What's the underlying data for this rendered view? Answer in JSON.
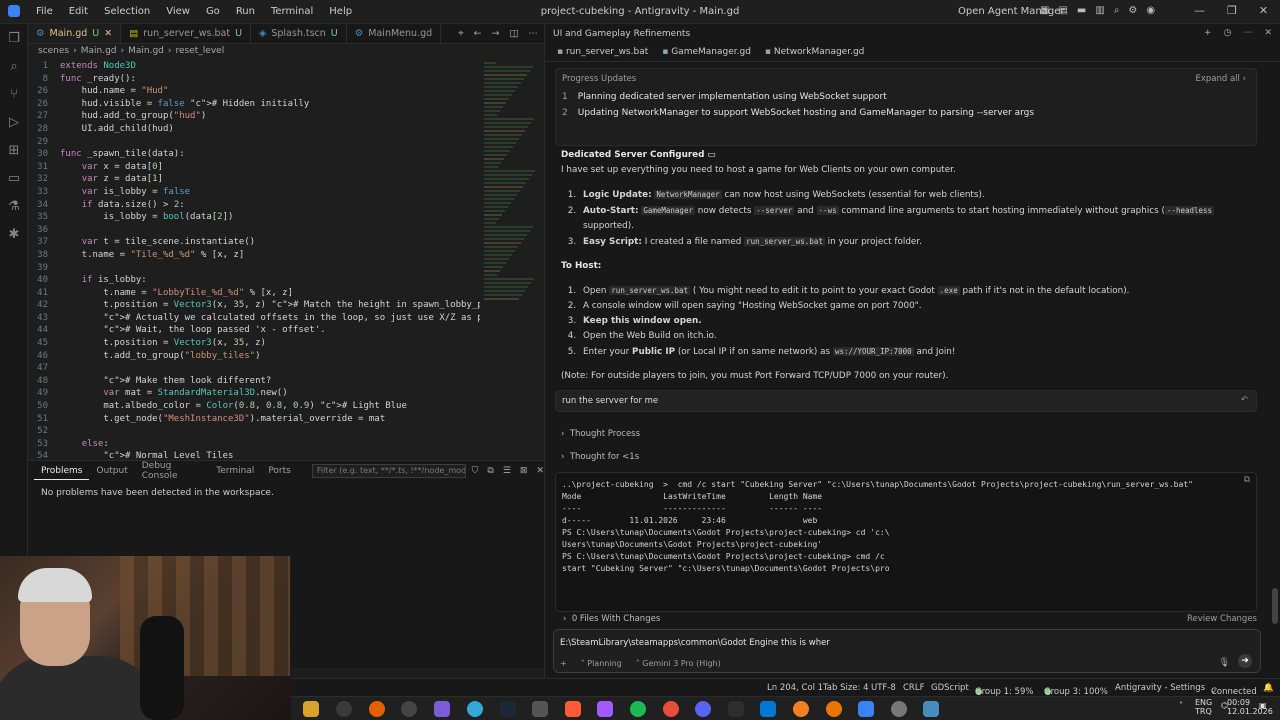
{
  "titlebar": {
    "menu": [
      "File",
      "Edit",
      "Selection",
      "View",
      "Go",
      "Run",
      "Terminal",
      "Help"
    ],
    "title": "project-cubeking - Antigravity - Main.gd",
    "open_agent_manager": "Open Agent Manager"
  },
  "editor": {
    "tabs": [
      {
        "label": "Main.gd",
        "badge": "U",
        "active": true
      },
      {
        "label": "run_server_ws.bat",
        "badge": "U"
      },
      {
        "label": "Splash.tscn",
        "badge": "U"
      },
      {
        "label": "MainMenu.gd",
        "badge": ""
      }
    ],
    "breadcrumb": [
      "scenes",
      "Main.gd",
      "Main.gd",
      "reset_level"
    ],
    "code": [
      {
        "n": "1",
        "t": "extends Node3D"
      },
      {
        "n": "8",
        "t": "func _ready():"
      },
      {
        "n": "26",
        "t": "\thud.name = \"Hud\""
      },
      {
        "n": "26",
        "t": "\thud.visible = false # Hidden initially"
      },
      {
        "n": "27",
        "t": "\thud.add_to_group(\"hud\")"
      },
      {
        "n": "28",
        "t": "\tUI.add_child(hud)"
      },
      {
        "n": "29",
        "t": ""
      },
      {
        "n": "30",
        "t": "func _spawn_tile(data):"
      },
      {
        "n": "31",
        "t": "\tvar x = data[0]"
      },
      {
        "n": "32",
        "t": "\tvar z = data[1]"
      },
      {
        "n": "33",
        "t": "\tvar is_lobby = false"
      },
      {
        "n": "34",
        "t": "\tif data.size() > 2:"
      },
      {
        "n": "35",
        "t": "\t\tis_lobby = bool(data[2])"
      },
      {
        "n": "36",
        "t": ""
      },
      {
        "n": "37",
        "t": "\tvar t = tile_scene.instantiate()"
      },
      {
        "n": "38",
        "t": "\tt.name = \"Tile_%d_%d\" % [x, z]"
      },
      {
        "n": "39",
        "t": ""
      },
      {
        "n": "40",
        "t": "\tif is_lobby:"
      },
      {
        "n": "41",
        "t": "\t\tt.name = \"LobbyTile_%d_%d\" % [x, z]"
      },
      {
        "n": "42",
        "t": "\t\tt.position = Vector3(x, 35, z) # Match the height in spawn_lobby_platfo"
      },
      {
        "n": "43",
        "t": "\t\t# Actually we calculated offsets in the loop, so just use X/Z as positi"
      },
      {
        "n": "44",
        "t": "\t\t# Wait, the loop passed 'x - offset'."
      },
      {
        "n": "45",
        "t": "\t\tt.position = Vector3(x, 35, z)"
      },
      {
        "n": "46",
        "t": "\t\tt.add_to_group(\"lobby_tiles\")"
      },
      {
        "n": "47",
        "t": ""
      },
      {
        "n": "48",
        "t": "\t\t# Make them look different?"
      },
      {
        "n": "49",
        "t": "\t\tvar mat = StandardMaterial3D.new()"
      },
      {
        "n": "50",
        "t": "\t\tmat.albedo_color = Color(0.8, 0.8, 0.9) # Light Blue"
      },
      {
        "n": "51",
        "t": "\t\tt.get_node(\"MeshInstance3D\").material_override = mat"
      },
      {
        "n": "52",
        "t": ""
      },
      {
        "n": "53",
        "t": "\telse:"
      },
      {
        "n": "54",
        "t": "\t\t# Normal Level Tiles"
      }
    ]
  },
  "panel": {
    "tabs": [
      "Problems",
      "Output",
      "Debug Console",
      "Terminal",
      "Ports"
    ],
    "filter_placeholder": "Filter (e.g. text, **/*.ts, !**/node_modules/**)",
    "message": "No problems have been detected in the workspace."
  },
  "agent": {
    "header": "UI and Gameplay Refinements",
    "files": [
      "run_server_ws.bat",
      "GameManager.gd",
      "NetworkManager.gd"
    ],
    "progress_title": "Progress Updates",
    "expand_all": "Expand all",
    "progress": [
      {
        "n": "1",
        "text": "Planning dedicated server implementation using WebSocket support"
      },
      {
        "n": "2",
        "text": "Updating NetworkManager to support WebSocket hosting and GameManager to parsing --server args"
      }
    ],
    "msg_title": "Dedicated Server Configured",
    "msg_intro": "I have set up everything you need to host a game for Web Clients on your own computer.",
    "b1_lead": "Logic Update:",
    "b1_code": "NetworkManager",
    "b1_rest": "can now host using WebSockets (essential for web clients).",
    "b2_lead": "Auto-Start:",
    "b2_code": "GameManager",
    "b2_mid": "now detects",
    "b2_code2": "--server",
    "b2_and": "and",
    "b2_code3": "--ws",
    "b2_rest": "command line arguments to start hosting immediately without graphics (",
    "b2_code4": "--headless",
    "b2_end": "supported).",
    "b3_lead": "Easy Script:",
    "b3_mid": "I created a file named",
    "b3_code": "run_server_ws.bat",
    "b3_rest": "in your project folder.",
    "to_host": "To Host:",
    "h1_a": "Open",
    "h1_code": "run_server_ws.bat",
    "h1_b": "( You might need to edit it to point to your exact Godot",
    "h1_code2": ".exe",
    "h1_c": "path if it's not in the default location).",
    "h2": "A console window will open saying \"Hosting WebSocket game on port 7000\".",
    "h3": "Keep this window open.",
    "h4": "Open the Web Build on itch.io.",
    "h5_a": "Enter your",
    "h5_b": "Public IP",
    "h5_c": "(or Local IP if on same network) as",
    "h5_code": "ws://YOUR_IP:7000",
    "h5_d": "and Join!",
    "note": "(Note: For outside players to join, you must Port Forward TCP/UDP 7000 on your router).",
    "user_message": "run the servver for me",
    "thought1": "Thought Process",
    "thought2": "Thought for <1s",
    "terminal": [
      "..\\project-cubeking  >  cmd /c start \"Cubeking Server\" \"c:\\Users\\tunap\\Documents\\Godot Projects\\project-cubeking\\run_server_ws.bat\"",
      "",
      "Mode                 LastWriteTime         Length Name",
      "----                 -------------         ------ ----",
      "d-----        11.01.2026     23:46                web",
      "",
      "",
      "PS C:\\Users\\tunap\\Documents\\Godot Projects\\project-cubeking> cd 'c:\\",
      "Users\\tunap\\Documents\\Godot Projects\\project-cubeking'",
      "PS C:\\Users\\tunap\\Documents\\Godot Projects\\project-cubeking> cmd /c",
      "start \"Cubeking Server\" \"c:\\Users\\tunap\\Documents\\Godot Projects\\pro"
    ],
    "files_changes": "0 Files With Changes",
    "review_changes": "Review Changes",
    "input_value": "E:\\SteamLibrary\\steamapps\\common\\Godot Engine this is wher",
    "mode": "Planning",
    "model": "Gemini 3 Pro (High)"
  },
  "status": {
    "pos": "Ln 204, Col 1",
    "tab": "Tab Size: 4",
    "enc": "UTF-8",
    "eol": "CRLF",
    "lang": "GDScript",
    "g1": "Group 1: 59%",
    "g3": "Group 3: 100%",
    "settings": "Antigravity - Settings",
    "conn": "Connected"
  },
  "tray": {
    "lang1": "ENG",
    "lang2": "TRQ",
    "time": "00:09",
    "date": "12.01.2026"
  },
  "colors": {
    "accent": "#0078d4",
    "modified": "#e2c08d",
    "untracked": "#73c991"
  }
}
